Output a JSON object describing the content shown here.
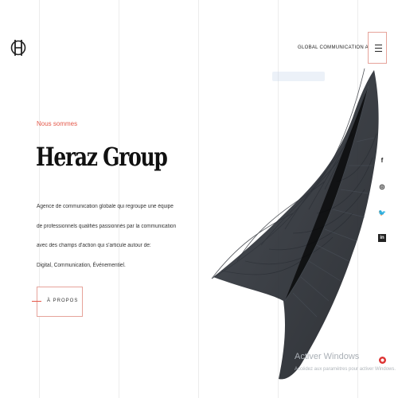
{
  "header": {
    "agency": "GLOBAL COMMUNICATION AGENCY",
    "menu_icon": "hamburger-icon"
  },
  "hero": {
    "eyebrow": "Nous sommes",
    "title": "Heraz Group",
    "description": [
      "Agence de communication globale qui regroupe une équipe",
      "de professionnels qualifiés passionnés par la communication",
      "avec des champs d'action qui s'articule autour de:",
      "Digital, Communication, Événementiel."
    ],
    "button_label": "À PROPOS"
  },
  "socials": [
    {
      "icon": "facebook-icon",
      "glyph": "f"
    },
    {
      "icon": "instagram-icon",
      "glyph": "◎"
    },
    {
      "icon": "twitter-icon",
      "glyph": "🐦"
    },
    {
      "icon": "linkedin-icon",
      "glyph": "in"
    }
  ],
  "windows_watermark": {
    "title": "Activer Windows",
    "subtitle": "Accédez aux paramètres pour activer Windows."
  },
  "colors": {
    "accent": "#e4584a",
    "border_accent": "#e6a39a",
    "text": "#111111"
  }
}
